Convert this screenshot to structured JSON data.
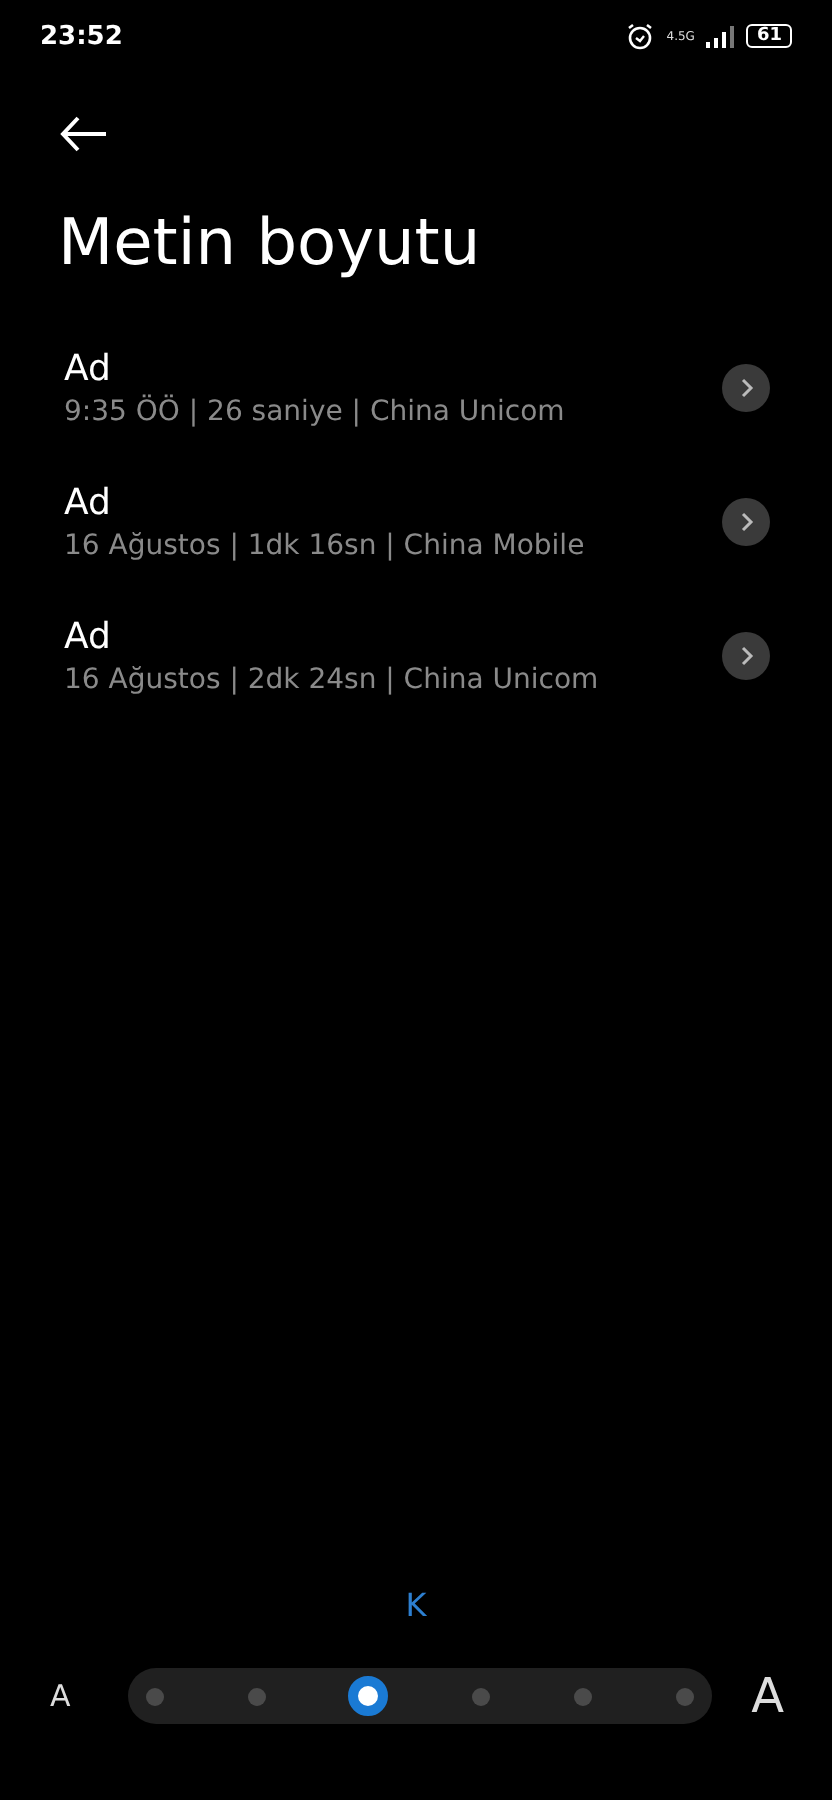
{
  "status_bar": {
    "time": "23:52",
    "network": "4.5G",
    "battery": "61"
  },
  "title": "Metin boyutu",
  "calls": [
    {
      "name": "Ad",
      "detail": "9:35 ÖÖ | 26 saniye | China Unicom"
    },
    {
      "name": "Ad",
      "detail": "16 Ağustos | 1dk 16sn | China Mobile"
    },
    {
      "name": "Ad",
      "detail": "16 Ağustos | 2dk 24sn | China Unicom"
    }
  ],
  "size_label": "K",
  "size_slider": {
    "small_label": "A",
    "large_label": "A",
    "steps": [
      {
        "selected": false
      },
      {
        "selected": false
      },
      {
        "selected": true
      },
      {
        "selected": false
      },
      {
        "selected": false
      },
      {
        "selected": false
      }
    ]
  }
}
